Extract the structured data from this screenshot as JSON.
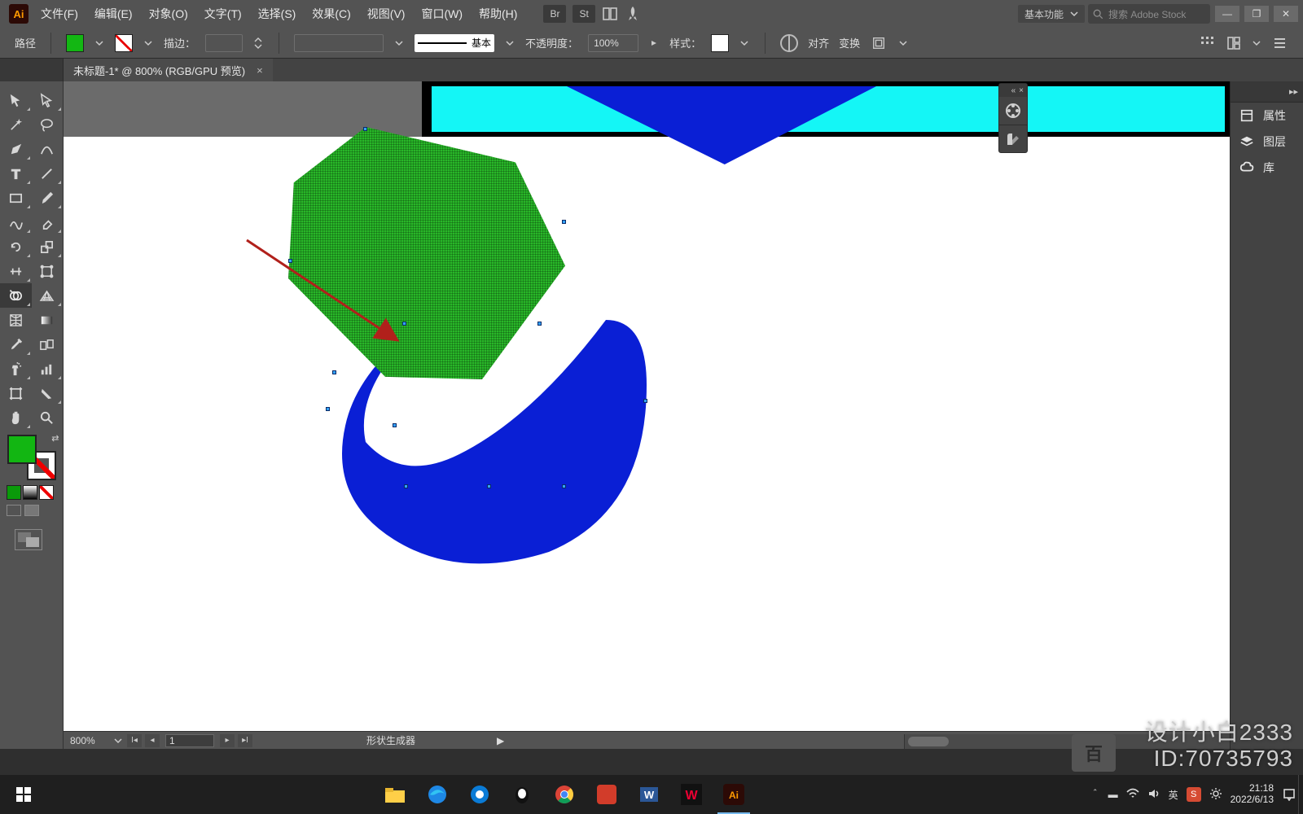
{
  "app": {
    "logo_text": "Ai"
  },
  "menus": [
    "文件(F)",
    "编辑(E)",
    "对象(O)",
    "文字(T)",
    "选择(S)",
    "效果(C)",
    "视图(V)",
    "窗口(W)",
    "帮助(H)"
  ],
  "menubar_right": {
    "br_label": "Br",
    "st_label": "St",
    "workspace_label": "基本功能",
    "search_placeholder": "搜索 Adobe Stock"
  },
  "options": {
    "mode_label": "路径",
    "stroke_label": "描边：",
    "stroke_style_label": "基本",
    "opacity_label": "不透明度：",
    "opacity_value": "100%",
    "style_label": "样式：",
    "align_label": "对齐",
    "transform_label": "变换"
  },
  "doc_tab": {
    "title": "未标题-1* @ 800% (RGB/GPU 预览)",
    "close": "×"
  },
  "right_panels": [
    {
      "icon": "properties",
      "label": "属性"
    },
    {
      "icon": "layers",
      "label": "图层"
    },
    {
      "icon": "cc",
      "label": "库"
    }
  ],
  "status": {
    "zoom": "800%",
    "page": "1",
    "tool_label": "形状生成器",
    "play": "▶"
  },
  "watermark": {
    "line1": "设计小白2333",
    "line2": "ID:70735793",
    "badge": "百"
  },
  "taskbar": {
    "tray_lang": "英",
    "time": "21:18",
    "date": "2022/6/13"
  },
  "colors": {
    "green": "#13b713",
    "blue": "#0a1fd5",
    "cyan": "#14f6f6",
    "arrow": "#b1201b"
  }
}
